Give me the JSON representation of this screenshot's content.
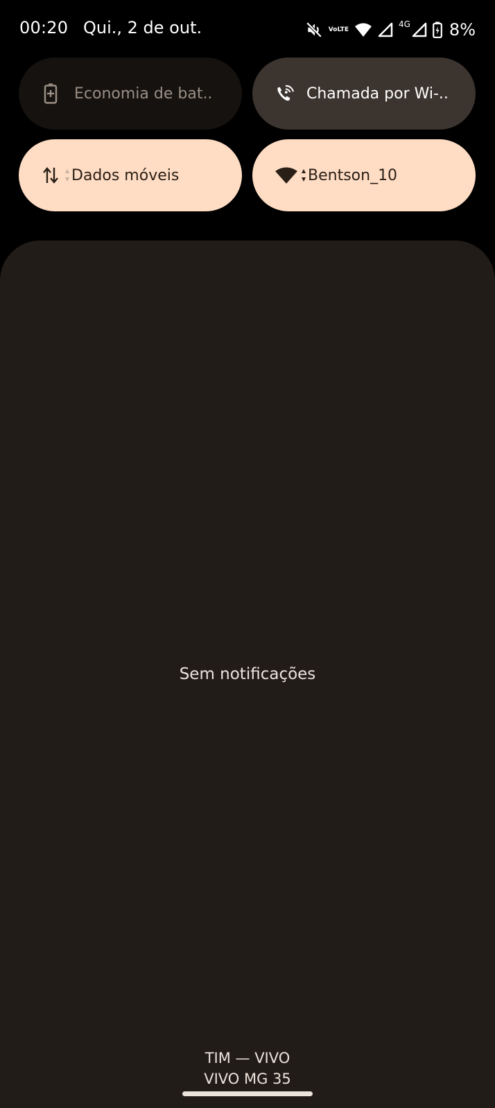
{
  "status_bar": {
    "time": "00:20",
    "date": "Qui., 2 de out.",
    "volte_line1": "Vo",
    "volte_line2": "LTE",
    "network_type": "4G",
    "battery_percent": "8%",
    "icons": [
      "mute-icon",
      "volte-icon",
      "wifi-icon",
      "signal-icon",
      "signal-icon",
      "battery-charging-icon"
    ]
  },
  "quick_tiles": [
    {
      "label": "Economia de bat..",
      "icon": "battery-saver-icon",
      "state": "off"
    },
    {
      "label": "Chamada por Wi-..",
      "icon": "wifi-calling-icon",
      "state": "unavailable"
    },
    {
      "label": "Dados móveis",
      "icon": "mobile-data-icon",
      "state": "on"
    },
    {
      "label": "Bentson_10",
      "icon": "wifi-icon",
      "state": "on"
    }
  ],
  "notifications": {
    "empty_message": "Sem notificações"
  },
  "footer": {
    "carrier_line1": "TIM — VIVO",
    "carrier_line2": "VIVO MG 35"
  },
  "colors": {
    "background": "#000000",
    "shade": "#221c18",
    "tile_active": "#ffdcc4",
    "tile_inactive": "#15120f",
    "tile_unavailable": "#3c342e"
  }
}
